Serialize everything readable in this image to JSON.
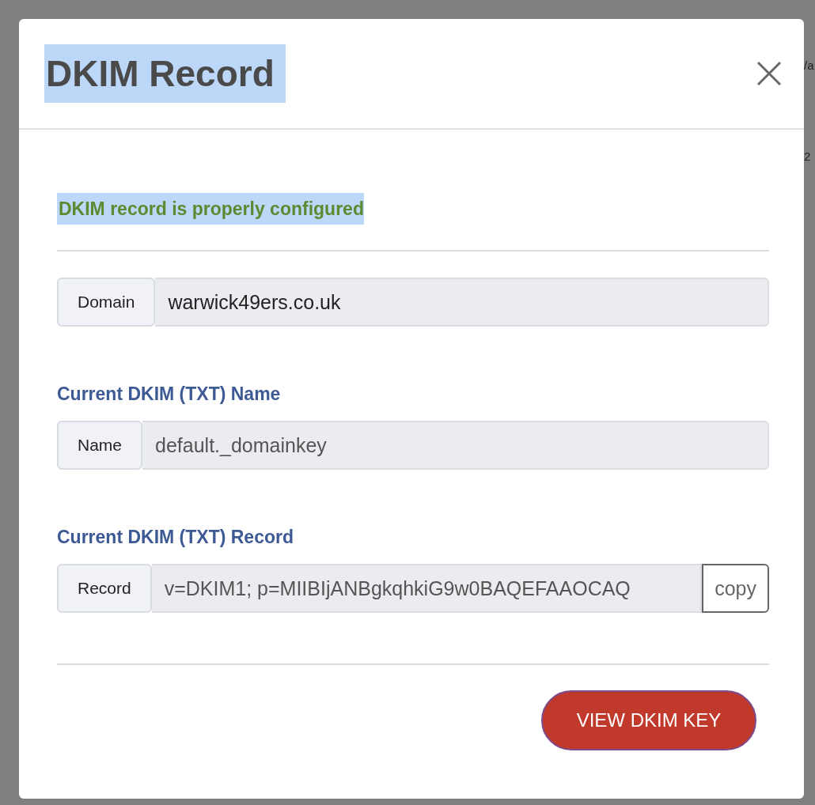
{
  "background_page": {
    "fragments": [
      "/a",
      "2"
    ]
  },
  "dialog": {
    "title": {
      "text": "DKIM Record",
      "highlighted": true
    },
    "status": {
      "text": "DKIM record is properly configured",
      "highlighted": true
    },
    "fields": [
      {
        "kind": "strong",
        "addon": "Domain",
        "value": "warwick49ers.co.uk"
      },
      {
        "kind": "muted",
        "heading": "Current DKIM (TXT) Name",
        "addon": "Name",
        "value": "default._domainkey"
      },
      {
        "kind": "muted",
        "heading": "Current DKIM (TXT) Record",
        "addon": "Record",
        "value": "v=DKIM1; p=MIIBIjANBgkqhkiG9w0BAQEFAAOCAQ",
        "action": "copy"
      }
    ],
    "button": "VIEW DKIM KEY"
  }
}
